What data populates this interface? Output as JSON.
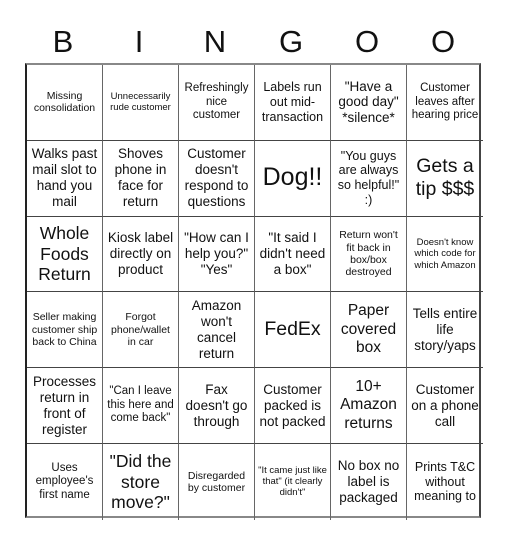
{
  "header": {
    "letters": [
      "B",
      "I",
      "N",
      "G",
      "O",
      "O"
    ]
  },
  "board": {
    "rows": [
      [
        "Missing consolidation",
        "Unnecessarily rude customer",
        "Refreshingly nice customer",
        "Labels run out mid-transaction",
        "\"Have a good day\" *silence*",
        "Customer leaves after hearing price"
      ],
      [
        "Walks past mail slot to hand you mail",
        "Shoves phone in face for return",
        "Customer doesn't respond to questions",
        "Dog!!",
        "\"You guys are always so helpful!\" :)",
        "Gets a tip $$$"
      ],
      [
        "Whole Foods Return",
        "Kiosk label directly on product",
        "\"How can I help you?\" \"Yes\"",
        "\"It said I didn't need a box\"",
        "Return won't fit back in box/box destroyed",
        "Doesn't know which code for which Amazon"
      ],
      [
        "Seller making customer ship back to China",
        "Forgot phone/wallet in car",
        "Amazon won't cancel return",
        "FedEx",
        "Paper covered box",
        "Tells entire life story/yaps"
      ],
      [
        "Processes return in front of register",
        "\"Can I leave this here and come back\"",
        "Fax doesn't go through",
        "Customer packed is not packed",
        "10+ Amazon returns",
        "Customer on a phone call"
      ],
      [
        "Uses employee's first name",
        "\"Did the store move?\"",
        "Disregarded by customer",
        "\"It came just like that\" (it clearly didn't\"",
        "No box no label is packaged",
        "Prints T&C without meaning to"
      ]
    ]
  }
}
